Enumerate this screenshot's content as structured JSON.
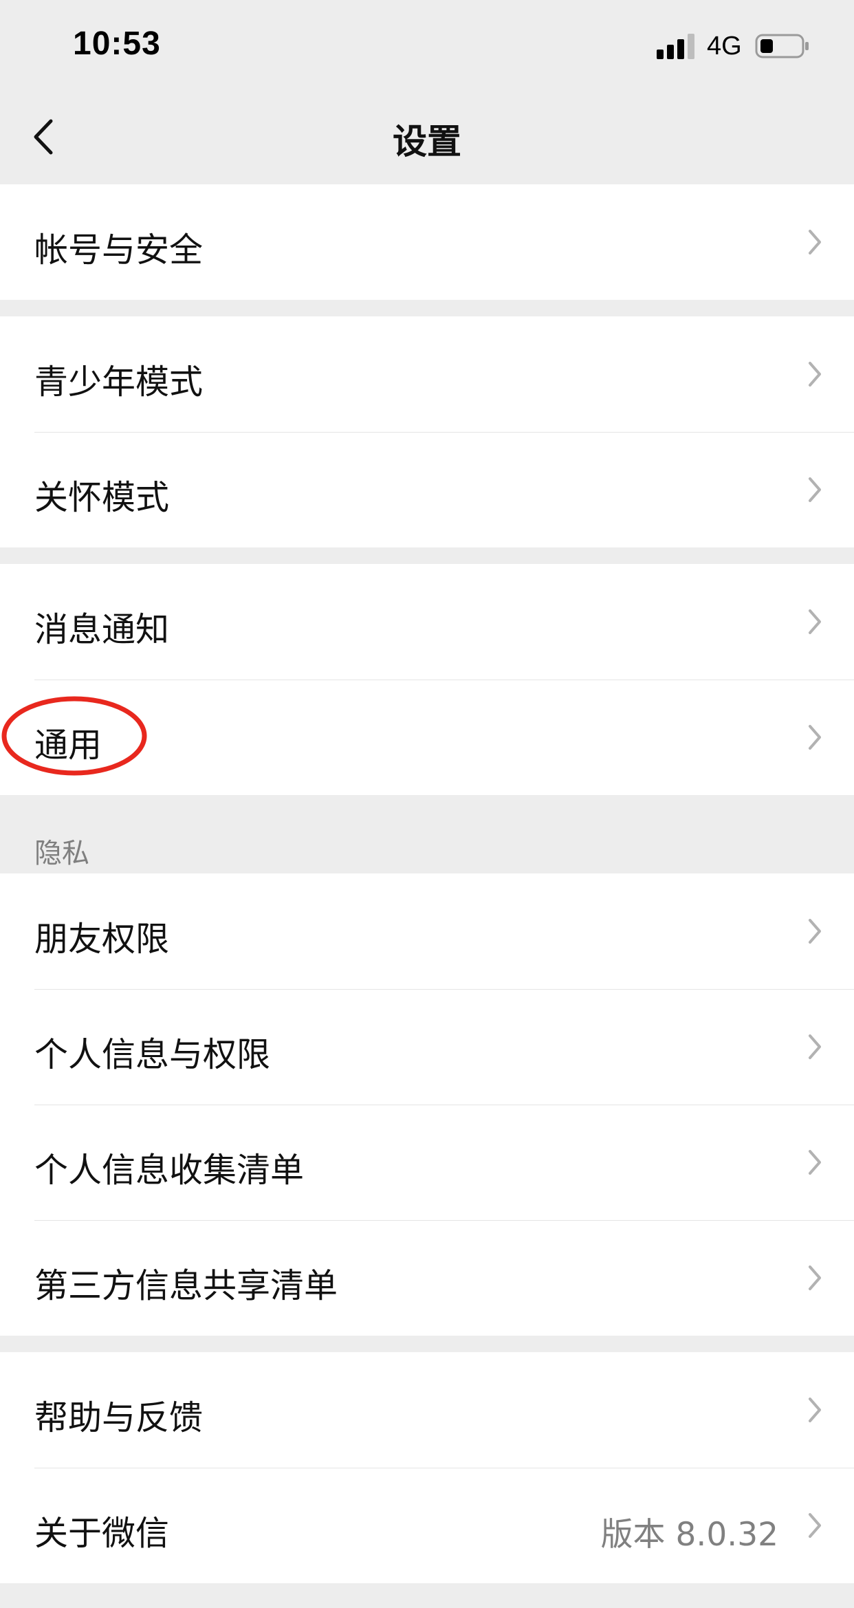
{
  "status_bar": {
    "time": "10:53",
    "network": "4G",
    "signal_icon": "signal-bars-icon",
    "battery_icon": "battery-icon"
  },
  "nav": {
    "title": "设置",
    "back_icon": "chevron-left-icon"
  },
  "groups": [
    {
      "items": [
        {
          "label": "帐号与安全"
        }
      ]
    },
    {
      "items": [
        {
          "label": "青少年模式"
        },
        {
          "label": "关怀模式"
        }
      ]
    },
    {
      "items": [
        {
          "label": "消息通知"
        },
        {
          "label": "通用"
        }
      ]
    },
    {
      "header": "隐私",
      "items": [
        {
          "label": "朋友权限"
        },
        {
          "label": "个人信息与权限"
        },
        {
          "label": "个人信息收集清单"
        },
        {
          "label": "第三方信息共享清单"
        }
      ]
    },
    {
      "items": [
        {
          "label": "帮助与反馈"
        },
        {
          "label": "关于微信",
          "value": "版本 8.0.32"
        }
      ]
    }
  ],
  "annotation": {
    "color": "#e8281e",
    "target": "通用"
  }
}
